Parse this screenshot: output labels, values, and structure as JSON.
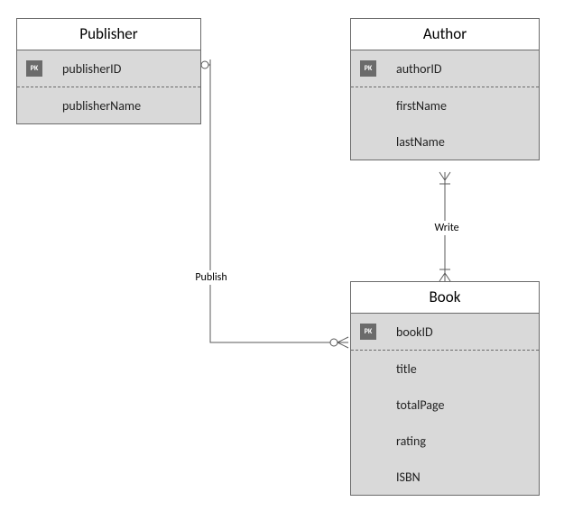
{
  "entities": {
    "publisher": {
      "name": "Publisher",
      "pk_label": "PK",
      "attrs": [
        "publisherID",
        "publisherName"
      ]
    },
    "author": {
      "name": "Author",
      "pk_label": "PK",
      "attrs": [
        "authorID",
        "firstName",
        "lastName"
      ]
    },
    "book": {
      "name": "Book",
      "pk_label": "PK",
      "attrs": [
        "bookID",
        "title",
        "totalPage",
        "rating",
        "ISBN"
      ]
    }
  },
  "relationships": {
    "publish": {
      "label": "Publish"
    },
    "write": {
      "label": "Write"
    }
  }
}
